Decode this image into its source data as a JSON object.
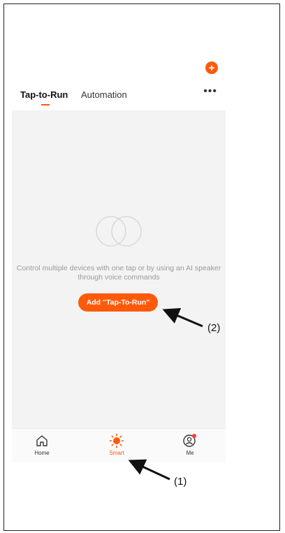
{
  "header": {
    "add_symbol": "+"
  },
  "tabs": [
    {
      "label": "Tap-to-Run",
      "active": true
    },
    {
      "label": "Automation",
      "active": false
    }
  ],
  "more_label": "•••",
  "empty_state": {
    "text": "Control multiple devices with one tap or by using an AI speaker through voice commands",
    "button_label": "Add \"Tap-To-Run\""
  },
  "bottom_nav": [
    {
      "label": "Home",
      "icon": "home-icon",
      "active": false
    },
    {
      "label": "Smart",
      "icon": "sun-icon",
      "active": true
    },
    {
      "label": "Me",
      "icon": "user-icon",
      "active": false,
      "badge": true
    }
  ],
  "annotations": {
    "label_1": "(1)",
    "label_2": "(2)"
  },
  "colors": {
    "accent": "#ff5a0a",
    "content_bg": "#f3f3f3",
    "muted_text": "#9a9a9a"
  }
}
